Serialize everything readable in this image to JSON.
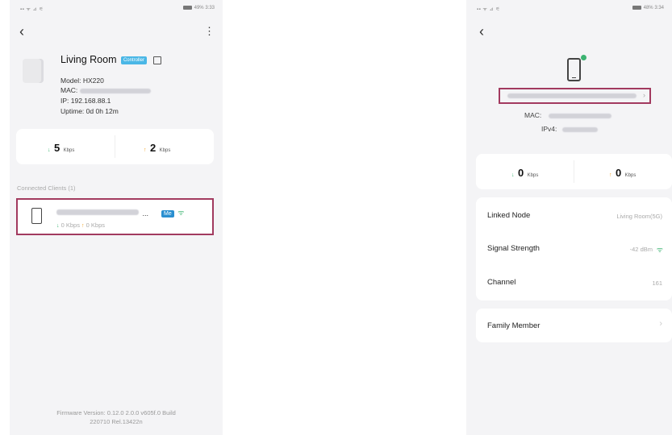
{
  "left_screen": {
    "status_time": "3:33",
    "status_battery": "49%",
    "device_name": "Living Room",
    "controller_badge": "Controller",
    "model": "Model: HX220",
    "mac_label": "MAC:",
    "ip": "IP: 192.168.88.1",
    "uptime": "Uptime: 0d 0h 12m",
    "download_value": "5",
    "download_unit": "Kbps",
    "upload_value": "2",
    "upload_unit": "Kbps",
    "clients_header": "Connected Clients (1)",
    "client": {
      "name_suffix": "...",
      "me_badge": "Me",
      "speeds": "0 Kbps",
      "speeds_up": "0 Kbps"
    },
    "firmware_line1": "Firmware Version: 0.12.0 2.0.0 v605f.0 Build",
    "firmware_line2": "220710 Rel.13422n"
  },
  "right_screen": {
    "status_time": "3:34",
    "status_battery": "48%",
    "mac_label": "MAC:",
    "ipv4_label": "IPv4:",
    "download_value": "0",
    "download_unit": "Kbps",
    "upload_value": "0",
    "upload_unit": "Kbps",
    "rows": [
      {
        "label": "Linked Node",
        "value": "Living Room(5G)"
      },
      {
        "label": "Signal Strength",
        "value": "-42 dBm"
      },
      {
        "label": "Channel",
        "value": "161"
      }
    ],
    "family_member_label": "Family Member"
  },
  "colors": {
    "controller_badge": "#4ab7e6",
    "me_badge": "#2a8fd0",
    "highlight_border": "#a23a5f",
    "online_dot": "#3cb371",
    "download_arrow": "#3cb371",
    "upload_arrow": "#f0a020"
  }
}
